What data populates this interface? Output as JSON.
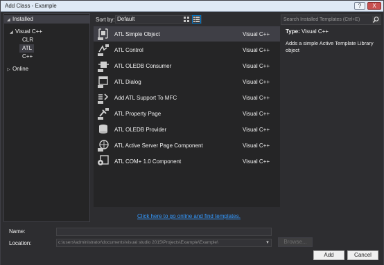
{
  "window": {
    "title": "Add Class - Example",
    "help_label": "?",
    "close_label": "X"
  },
  "sidebar": {
    "items": [
      {
        "label": "Installed",
        "arrow": "◢"
      },
      {
        "label": "Visual C++",
        "arrow": "◢"
      },
      {
        "label": "CLR"
      },
      {
        "label": "ATL"
      },
      {
        "label": "C++"
      },
      {
        "label": "Online",
        "arrow": "▷"
      }
    ]
  },
  "toolbar": {
    "sort_label": "Sort by:",
    "sort_value": "Default"
  },
  "templates": [
    {
      "name": "ATL Simple Object",
      "lang": "Visual C++",
      "icon": "atl-simple-object-icon"
    },
    {
      "name": "ATL Control",
      "lang": "Visual C++",
      "icon": "atl-control-icon"
    },
    {
      "name": "ATL OLEDB Consumer",
      "lang": "Visual C++",
      "icon": "atl-oledb-consumer-icon"
    },
    {
      "name": "ATL Dialog",
      "lang": "Visual C++",
      "icon": "atl-dialog-icon"
    },
    {
      "name": "Add ATL Support To MFC",
      "lang": "Visual C++",
      "icon": "atl-support-mfc-icon"
    },
    {
      "name": "ATL Property Page",
      "lang": "Visual C++",
      "icon": "atl-property-page-icon"
    },
    {
      "name": "ATL OLEDB Provider",
      "lang": "Visual C++",
      "icon": "atl-oledb-provider-icon"
    },
    {
      "name": "ATL Active Server Page Component",
      "lang": "Visual C++",
      "icon": "atl-asp-component-icon"
    },
    {
      "name": "ATL COM+ 1.0 Component",
      "lang": "Visual C++",
      "icon": "atl-com-component-icon"
    }
  ],
  "search": {
    "placeholder": "Search Installed Templates (Ctrl+E)"
  },
  "details": {
    "type_label": "Type:",
    "type_value": "Visual C++",
    "description": "Adds a simple Active Template Library object"
  },
  "online_link": "Click here to go online and find templates.",
  "form": {
    "name_label": "Name:",
    "name_value": "",
    "location_label": "Location:",
    "location_value": "c:\\users\\administrator\\documents\\visual studio 2015\\Projects\\Example\\Example\\",
    "browse_label": "Browse...",
    "add_label": "Add",
    "cancel_label": "Cancel"
  },
  "colors": {
    "accent": "#007acc",
    "link": "#3399ff",
    "background": "#2d2d30",
    "panel": "#252526"
  }
}
